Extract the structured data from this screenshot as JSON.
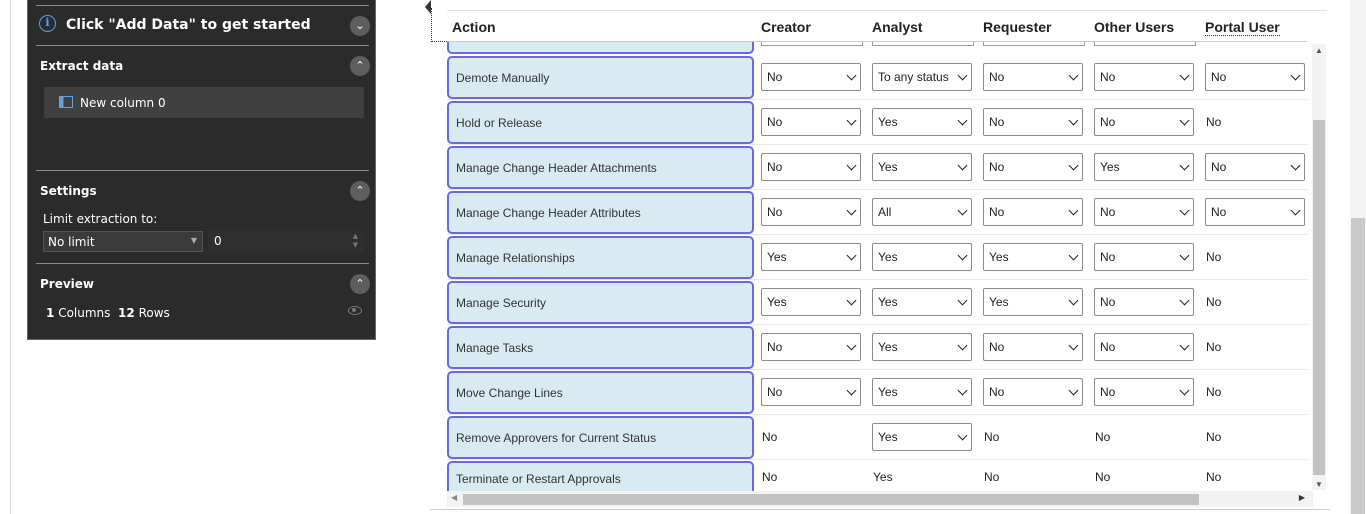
{
  "panel": {
    "title": "Click \"Add Data\" to get started",
    "extract_header": "Extract data",
    "new_column": "New column 0",
    "settings_header": "Settings",
    "limit_label": "Limit extraction to:",
    "limit_select": "No limit",
    "limit_value": "0",
    "preview_header": "Preview",
    "columns_count": "1",
    "columns_word": "Columns",
    "rows_count": "12",
    "rows_word": "Rows"
  },
  "grid": {
    "headers": [
      "Action",
      "Creator",
      "Analyst",
      "Requester",
      "Other Users",
      "Portal User"
    ],
    "rows": [
      {
        "action": "Demote Manually",
        "cells": [
          [
            "sel",
            "No"
          ],
          [
            "sel",
            "To any status"
          ],
          [
            "sel",
            "No"
          ],
          [
            "sel",
            "No"
          ],
          [
            "sel",
            "No"
          ]
        ]
      },
      {
        "action": "Hold or Release",
        "cells": [
          [
            "sel",
            "No"
          ],
          [
            "sel",
            "Yes"
          ],
          [
            "sel",
            "No"
          ],
          [
            "sel",
            "No"
          ],
          [
            "txt",
            "No"
          ]
        ]
      },
      {
        "action": "Manage Change Header Attachments",
        "cells": [
          [
            "sel",
            "No"
          ],
          [
            "sel",
            "Yes"
          ],
          [
            "sel",
            "No"
          ],
          [
            "sel",
            "Yes"
          ],
          [
            "sel",
            "No"
          ]
        ]
      },
      {
        "action": "Manage Change Header Attributes",
        "cells": [
          [
            "sel",
            "No"
          ],
          [
            "sel",
            "All"
          ],
          [
            "sel",
            "No"
          ],
          [
            "sel",
            "No"
          ],
          [
            "sel",
            "No"
          ]
        ]
      },
      {
        "action": "Manage Relationships",
        "cells": [
          [
            "sel",
            "Yes"
          ],
          [
            "sel",
            "Yes"
          ],
          [
            "sel",
            "Yes"
          ],
          [
            "sel",
            "No"
          ],
          [
            "txt",
            "No"
          ]
        ]
      },
      {
        "action": "Manage Security",
        "cells": [
          [
            "sel",
            "Yes"
          ],
          [
            "sel",
            "Yes"
          ],
          [
            "sel",
            "Yes"
          ],
          [
            "sel",
            "No"
          ],
          [
            "txt",
            "No"
          ]
        ]
      },
      {
        "action": "Manage Tasks",
        "cells": [
          [
            "sel",
            "No"
          ],
          [
            "sel",
            "Yes"
          ],
          [
            "sel",
            "No"
          ],
          [
            "sel",
            "No"
          ],
          [
            "txt",
            "No"
          ]
        ]
      },
      {
        "action": "Move Change Lines",
        "cells": [
          [
            "sel",
            "No"
          ],
          [
            "sel",
            "Yes"
          ],
          [
            "sel",
            "No"
          ],
          [
            "sel",
            "No"
          ],
          [
            "txt",
            "No"
          ]
        ]
      },
      {
        "action": "Remove Approvers for Current Status",
        "cells": [
          [
            "txt",
            "No"
          ],
          [
            "sel",
            "Yes"
          ],
          [
            "txt",
            "No"
          ],
          [
            "txt",
            "No"
          ],
          [
            "txt",
            "No"
          ]
        ]
      },
      {
        "action": "Terminate or Restart Approvals",
        "cells": [
          [
            "txt",
            "No"
          ],
          [
            "txt",
            "Yes"
          ],
          [
            "txt",
            "No"
          ],
          [
            "txt",
            "No"
          ],
          [
            "txt",
            "No"
          ]
        ]
      }
    ]
  },
  "colors": {
    "panel_bg": "#2b2b2b",
    "action_bg": "#d8ebf3",
    "action_border": "#6b68e6",
    "info_blue": "#4aa3ff"
  }
}
